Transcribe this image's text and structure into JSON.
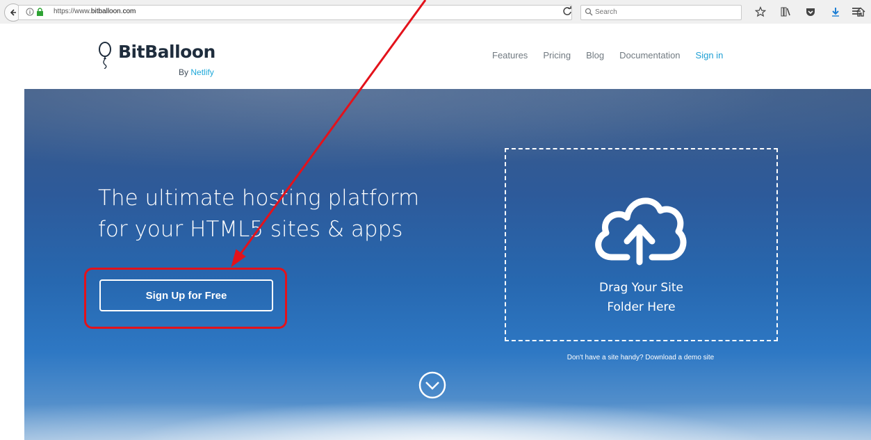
{
  "browser": {
    "url_prefix": "https://www.",
    "url_domain": "bitballoon.com",
    "search_placeholder": "Search"
  },
  "site": {
    "logo_text": "BitBalloon",
    "logo_by": "By",
    "logo_by_brand": "Netlify",
    "nav": [
      {
        "label": "Features"
      },
      {
        "label": "Pricing"
      },
      {
        "label": "Blog"
      },
      {
        "label": "Documentation"
      },
      {
        "label": "Sign in"
      }
    ]
  },
  "hero": {
    "title_line1": "The ultimate hosting platform",
    "title_line2": "for your HTML5 sites & apps",
    "signup_label": "Sign Up for Free",
    "drop_line1": "Drag Your Site",
    "drop_line2": "Folder Here",
    "demo_text": "Don't have a site handy? Download a demo site"
  },
  "icons": {
    "back": "back-arrow-icon",
    "info": "info-icon",
    "lock": "lock-icon",
    "reload": "reload-icon",
    "search": "search-icon",
    "bookmark": "star-icon",
    "library": "library-icon",
    "pocket": "pocket-icon",
    "downloads": "download-icon",
    "home": "home-icon",
    "menu": "hamburger-icon",
    "upload": "cloud-upload-icon",
    "scroll": "chevron-down-icon"
  },
  "colors": {
    "accent": "#1e9fd4",
    "annotation": "#e3121b"
  }
}
